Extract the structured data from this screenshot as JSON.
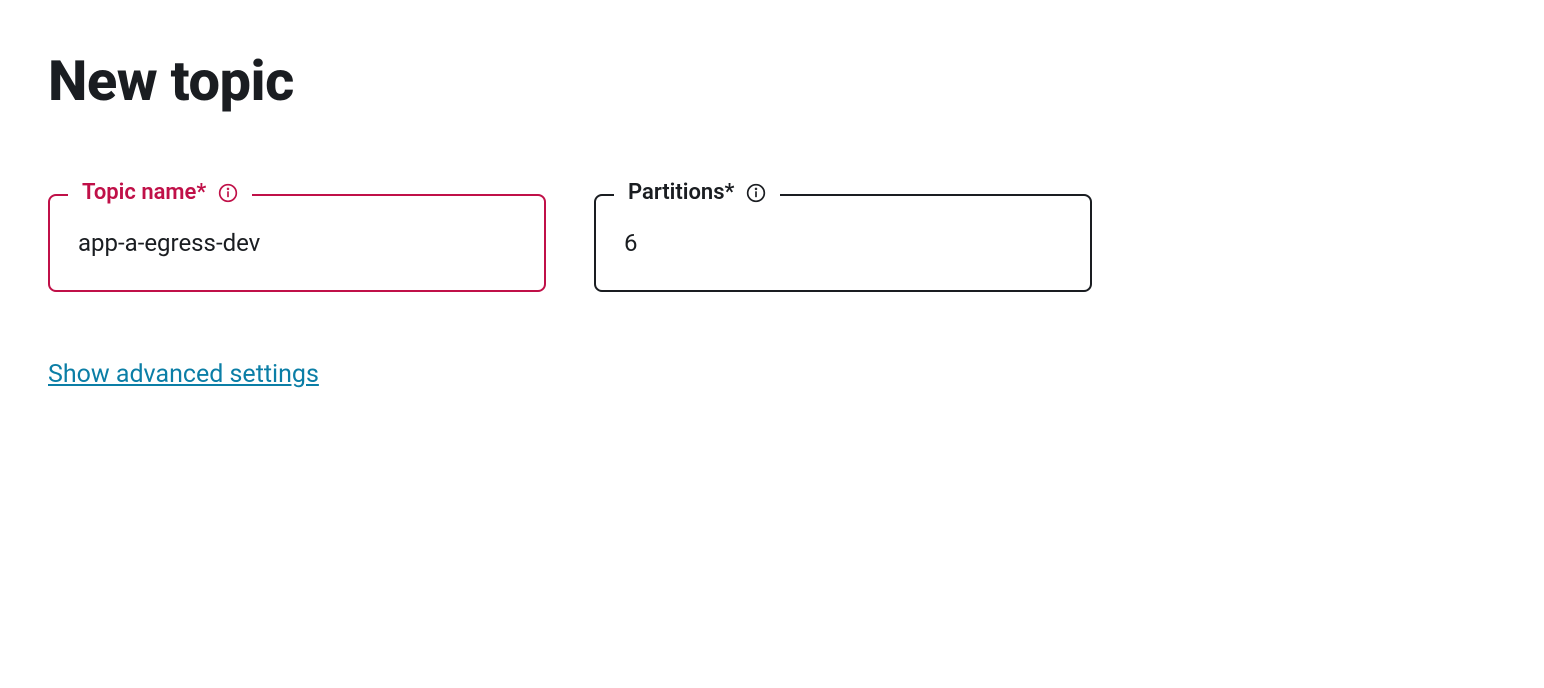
{
  "page": {
    "title": "New topic"
  },
  "form": {
    "topicName": {
      "label": "Topic name*",
      "value": "app-a-egress-dev"
    },
    "partitions": {
      "label": "Partitions*",
      "value": "6"
    }
  },
  "links": {
    "advanced": "Show advanced settings"
  }
}
